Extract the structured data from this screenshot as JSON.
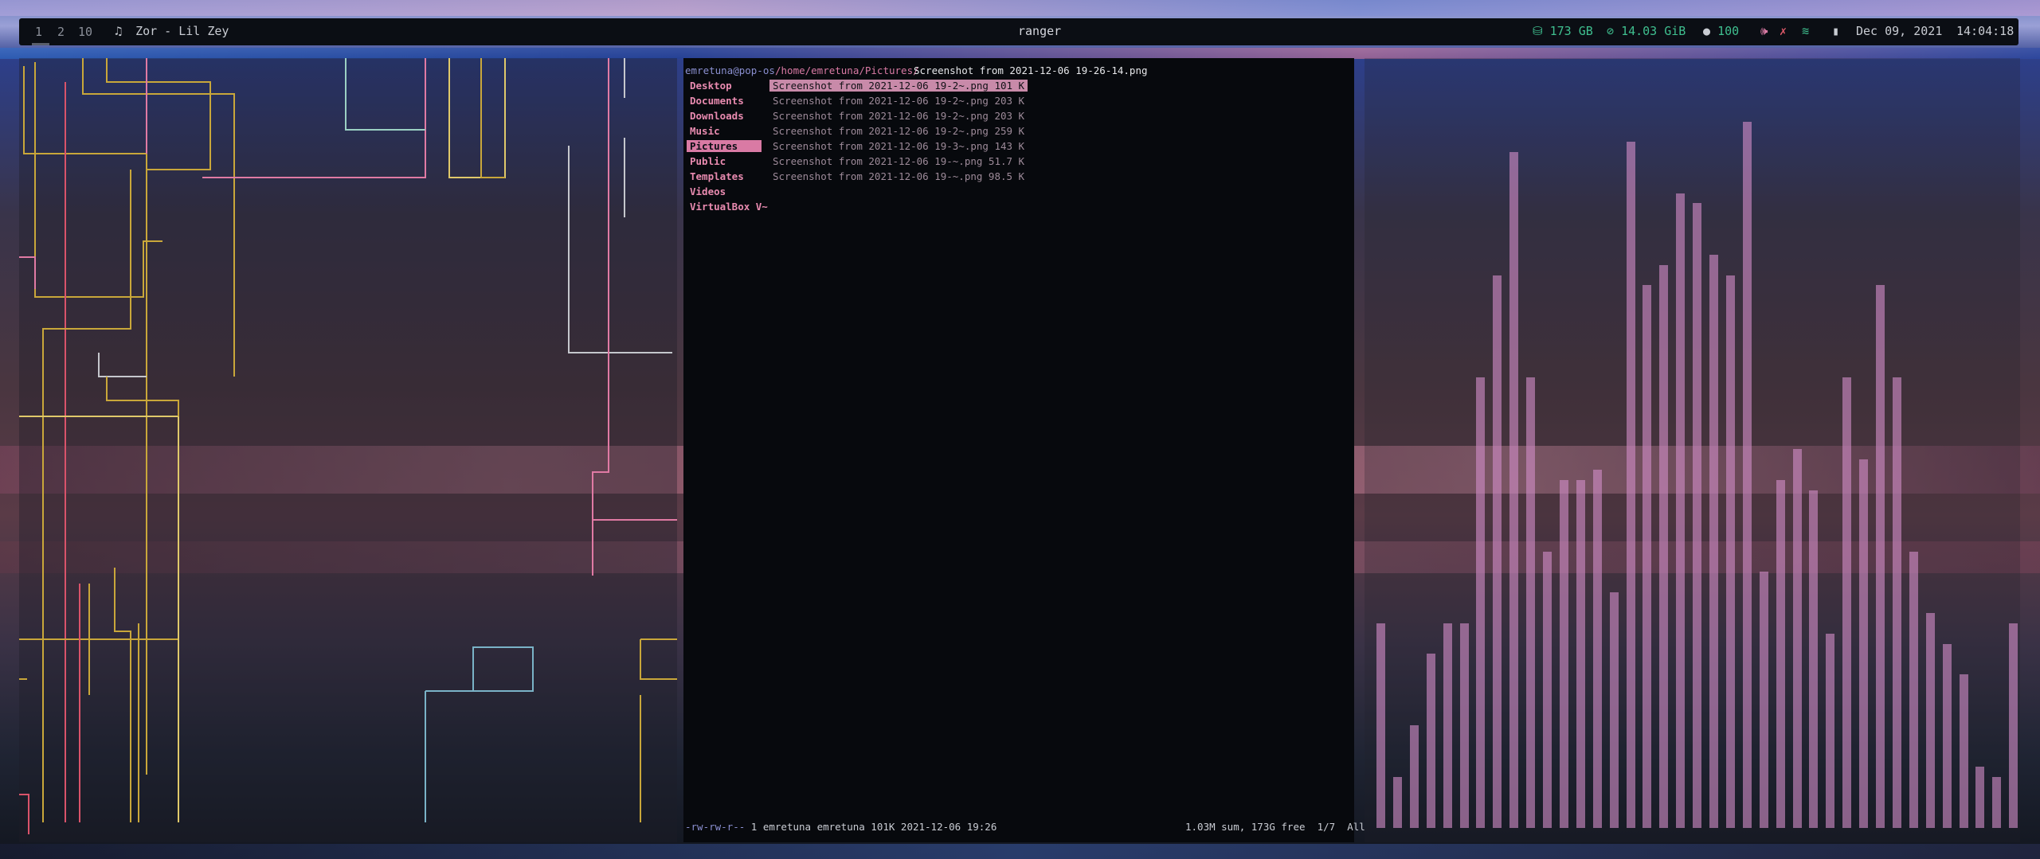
{
  "topbar": {
    "workspaces": [
      "1",
      "2",
      "10"
    ],
    "music_icon": "music-note-icon",
    "now_playing": "Zor - Lil Zey",
    "window_title": "ranger",
    "disk": "173 GB",
    "memory": "14.03 GiB",
    "battery": "100",
    "date": "Dec 09, 2021",
    "time": "14:04:18",
    "colors": {
      "green": "#3fbf8f",
      "pink": "#d97aa4"
    }
  },
  "ranger": {
    "prompt": "emretuna@pop-os",
    "path_dir": "/home/emretuna/Pictures/",
    "path_file": "Screenshot from 2021-12-06 19-26-14.png",
    "dirs": [
      "Desktop",
      "Documents",
      "Downloads",
      "Music",
      "Pictures",
      "Public",
      "Templates",
      "Videos",
      "VirtualBox V~"
    ],
    "selected_dir_index": 4,
    "files": [
      "Screenshot from 2021-12-06 19-2~.png 101 K",
      "Screenshot from 2021-12-06 19-2~.png 203 K",
      "Screenshot from 2021-12-06 19-2~.png 203 K",
      "Screenshot from 2021-12-06 19-2~.png 259 K",
      "Screenshot from 2021-12-06 19-3~.png 143 K",
      "Screenshot from 2021-12-06 19-~.png 51.7 K",
      "Screenshot from 2021-12-06 19-~.png 98.5 K"
    ],
    "selected_file_index": 0,
    "status_perm": "-rw-rw-r--",
    "status_info": " 1 emretuna emretuna 101K 2021-12-06 19:26",
    "status_right": "1.03M sum, 173G free  1/7  All"
  },
  "visualizer": {
    "levels": [
      0.2,
      0.05,
      0.1,
      0.17,
      0.2,
      0.2,
      0.44,
      0.54,
      0.66,
      0.44,
      0.27,
      0.34,
      0.34,
      0.35,
      0.23,
      0.67,
      0.53,
      0.55,
      0.62,
      0.61,
      0.56,
      0.54,
      0.69,
      0.25,
      0.34,
      0.37,
      0.33,
      0.19,
      0.44,
      0.36,
      0.53,
      0.44,
      0.27,
      0.21,
      0.18,
      0.15,
      0.06,
      0.05,
      0.2
    ]
  }
}
